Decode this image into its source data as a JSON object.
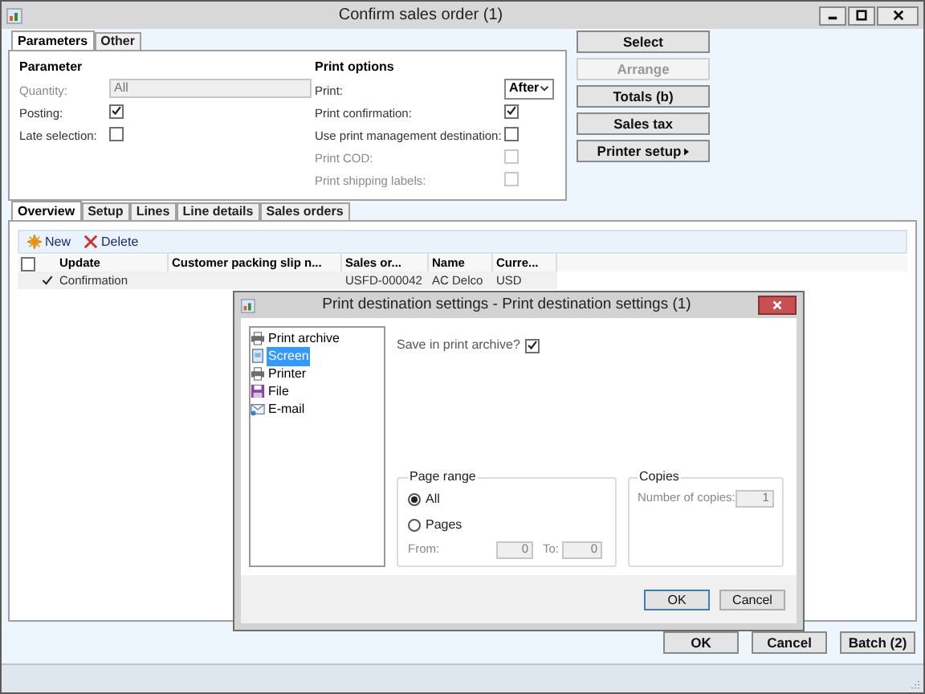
{
  "window": {
    "title": "Confirm sales order (1)"
  },
  "top_tabs": [
    {
      "label": "Parameters",
      "selected": true
    },
    {
      "label": "Other",
      "selected": false
    }
  ],
  "parameter": {
    "heading": "Parameter",
    "fields": [
      {
        "kind": "text",
        "label": "Quantity:",
        "value": "All",
        "disabled": true
      },
      {
        "kind": "checkbox",
        "label": "Posting:",
        "checked": true,
        "disabled": false
      },
      {
        "kind": "checkbox",
        "label": "Late selection:",
        "checked": false,
        "disabled": false
      }
    ]
  },
  "print_options": {
    "heading": "Print options",
    "fields": [
      {
        "kind": "select",
        "label": "Print:",
        "value": "After",
        "disabled": false
      },
      {
        "kind": "checkbox",
        "label": "Print confirmation:",
        "checked": true,
        "disabled": false
      },
      {
        "kind": "checkbox",
        "label": "Use print management destination:",
        "checked": false,
        "disabled": false
      },
      {
        "kind": "checkbox",
        "label": "Print COD:",
        "checked": false,
        "disabled": true
      },
      {
        "kind": "checkbox",
        "label": "Print shipping labels:",
        "checked": false,
        "disabled": true
      }
    ]
  },
  "side_buttons": [
    {
      "label": "Select",
      "disabled": false,
      "has_menu": false
    },
    {
      "label": "Arrange",
      "disabled": true,
      "has_menu": false
    },
    {
      "label": "Totals (b)",
      "disabled": false,
      "has_menu": false
    },
    {
      "label": "Sales tax",
      "disabled": false,
      "has_menu": false
    },
    {
      "label": "Printer setup",
      "disabled": false,
      "has_menu": true
    }
  ],
  "lower_tabs": [
    {
      "label": "Overview",
      "selected": true
    },
    {
      "label": "Setup",
      "selected": false
    },
    {
      "label": "Lines",
      "selected": false
    },
    {
      "label": "Line details",
      "selected": false
    },
    {
      "label": "Sales orders",
      "selected": false
    }
  ],
  "toolbar": [
    {
      "kind": "new",
      "label": "New"
    },
    {
      "kind": "delete",
      "label": "Delete"
    }
  ],
  "grid": {
    "select_all_checked": false,
    "columns": [
      "Update",
      "Customer packing slip n...",
      "Sales or...",
      "Name",
      "Curre..."
    ],
    "rows": [
      {
        "marked": true,
        "cells": [
          "Confirmation",
          null,
          "USFD-000042",
          "AC Delco",
          "USD"
        ]
      }
    ]
  },
  "bottom_buttons": [
    "OK",
    "Cancel",
    "Batch (2)"
  ],
  "dialog": {
    "title": "Print destination settings - Print destination settings (1)",
    "destinations": [
      {
        "kind": "printer",
        "label": "Print archive",
        "selected": false
      },
      {
        "kind": "screen",
        "label": "Screen",
        "selected": true
      },
      {
        "kind": "printer",
        "label": "Printer",
        "selected": false
      },
      {
        "kind": "file",
        "label": "File",
        "selected": false
      },
      {
        "kind": "email",
        "label": "E-mail",
        "selected": false
      }
    ],
    "save_in_archive": {
      "label": "Save in print archive?",
      "checked": true
    },
    "page_range": {
      "heading": "Page range",
      "options": [
        {
          "label": "All",
          "selected": true
        },
        {
          "label": "Pages",
          "selected": false
        }
      ],
      "from": {
        "label": "From:",
        "value": "0"
      },
      "to": {
        "label": "To:",
        "value": "0"
      }
    },
    "copies": {
      "heading": "Copies",
      "label": "Number of copies:",
      "value": "1"
    },
    "buttons": [
      "OK",
      "Cancel"
    ]
  }
}
